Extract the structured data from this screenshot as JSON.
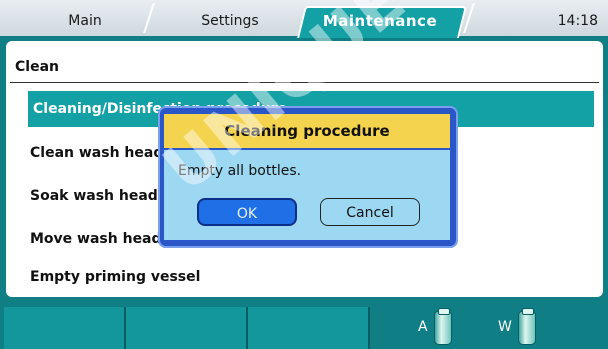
{
  "tabs": {
    "main": "Main",
    "settings": "Settings",
    "maintenance": "Maintenance"
  },
  "time": "14:18",
  "panel": {
    "title": "Clean",
    "items": [
      "Cleaning/Disinfection procedure",
      "Clean wash heads",
      "Soak wash heads",
      "Move wash heads",
      "Empty priming vessel"
    ]
  },
  "dialog": {
    "title": "Cleaning procedure",
    "message": "Empty all bottles.",
    "ok": "OK",
    "cancel": "Cancel"
  },
  "bottles": {
    "a": "A",
    "w": "W"
  },
  "watermark": "UNIQUE"
}
